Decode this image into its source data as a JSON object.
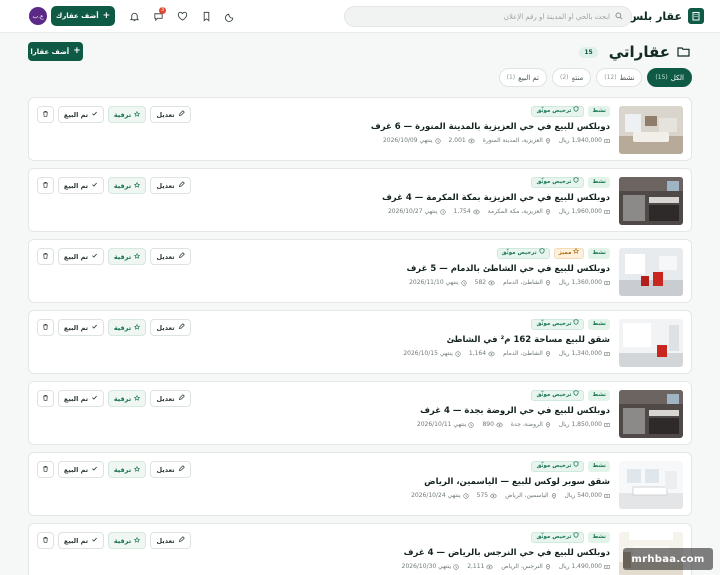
{
  "brand": {
    "name": "عقار بلس"
  },
  "search": {
    "placeholder": "ابحث بالحي أو المدينة أو رقم الإعلان"
  },
  "header": {
    "add_label": "أضف عقارك",
    "avatar_text": "ع.ب",
    "notification_count": "3",
    "icons": [
      "moon-icon",
      "bookmark-icon",
      "heart-icon",
      "messages-icon",
      "bell-icon"
    ]
  },
  "page": {
    "title": "عقاراتي",
    "count": "15",
    "add_label": "أضف عقارا"
  },
  "filters": [
    {
      "label": "الكل",
      "count": "(15)",
      "active": true
    },
    {
      "label": "نشط",
      "count": "(12)",
      "active": false
    },
    {
      "label": "منتهٍ",
      "count": "(2)",
      "active": false
    },
    {
      "label": "تم البيع",
      "count": "(1)",
      "active": false
    }
  ],
  "actions": {
    "edit": "تعديل",
    "promote": "ترقية",
    "sold": "تم البيع"
  },
  "tags": {
    "active": "نشط",
    "licensed": "ترخيص موثّق",
    "featured": "مميز"
  },
  "listings": [
    {
      "title": "دوبلكس للبيع في حي العزيزية بالمدينة المنورة — 6 غرف",
      "price": "1,940,000 ريال",
      "location": "العزيزية، المدينة المنورة",
      "views": "2,001",
      "expires": "ينتهي 2026/10/09",
      "featured": false,
      "photo": "living"
    },
    {
      "title": "دوبلكس للبيع في حي العزيزية بمكة المكرمة — 4 غرف",
      "price": "1,960,000 ريال",
      "location": "العزيزية، مكة المكرمة",
      "views": "1,754",
      "expires": "ينتهي 2026/10/27",
      "featured": false,
      "photo": "kitchen"
    },
    {
      "title": "دوبلكس للبيع في حي الشاطئ بالدمام — 5 غرف",
      "price": "1,360,000 ريال",
      "location": "الشاطئ، الدمام",
      "views": "582",
      "expires": "ينتهي 2026/11/10",
      "featured": true,
      "photo": "red"
    },
    {
      "title": "شقق للبيع مساحة 162 م² في الشاطئ",
      "price": "1,340,000 ريال",
      "location": "الشاطئ، الدمام",
      "views": "1,164",
      "expires": "ينتهي 2026/10/15",
      "featured": false,
      "photo": "red2"
    },
    {
      "title": "دوبلكس للبيع في حي الروضة بجدة — 4 غرف",
      "price": "1,850,000 ريال",
      "location": "الروضة، جدة",
      "views": "890",
      "expires": "ينتهي 2026/10/11",
      "featured": false,
      "photo": "kitchen"
    },
    {
      "title": "شقق سوبر لوكس للبيع — الياسمين، الرياض",
      "price": "540,000 ريال",
      "location": "الياسمين، الرياض",
      "views": "575",
      "expires": "ينتهي 2026/10/24",
      "featured": false,
      "photo": "white"
    },
    {
      "title": "دوبلكس للبيع في حي النرجس بالرياض — 4 غرف",
      "price": "1,490,000 ريال",
      "location": "النرجس، الرياض",
      "views": "2,111",
      "expires": "ينتهي 2026/10/30",
      "featured": false,
      "photo": "bright"
    }
  ],
  "watermark": "mrhbaa.com"
}
